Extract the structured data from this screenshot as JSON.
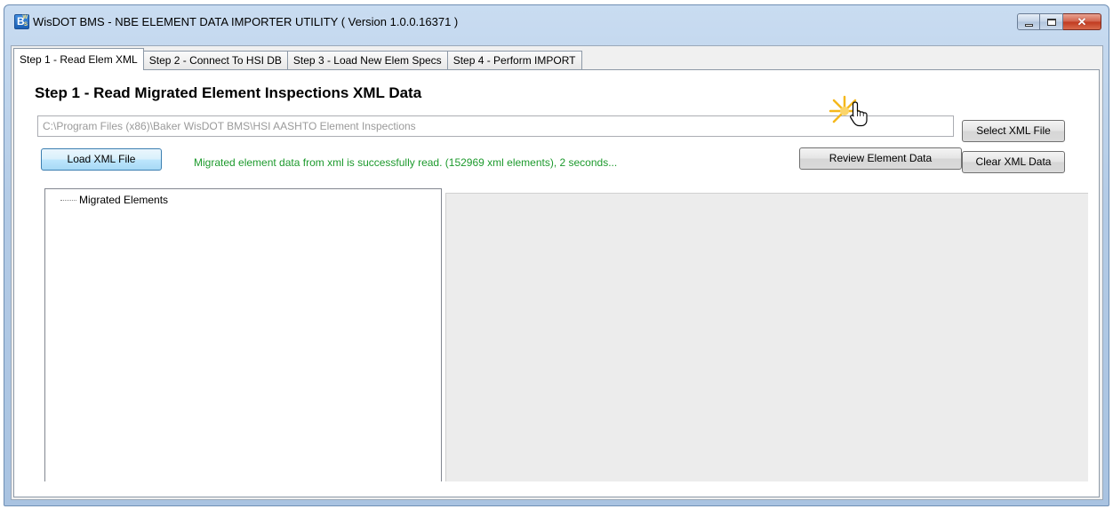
{
  "window": {
    "title": "WisDOT BMS - NBE ELEMENT DATA IMPORTER UTILITY ( Version 1.0.0.16371 )",
    "icon": "bms-app-icon",
    "icon_text": "B",
    "icon_sup": "W",
    "icon_sub": "S"
  },
  "tabs": [
    {
      "label": "Step 1 - Read Elem XML",
      "active": true
    },
    {
      "label": "Step 2 - Connect To HSI DB",
      "active": false
    },
    {
      "label": "Step 3 - Load New Elem Specs",
      "active": false
    },
    {
      "label": "Step 4 - Perform IMPORT",
      "active": false
    }
  ],
  "step1": {
    "heading": "Step 1 - Read Migrated Element Inspections XML Data",
    "path_value": "C:\\Program Files (x86)\\Baker WisDOT BMS\\HSI AASHTO Element Inspections",
    "select_xml_label": "Select XML File",
    "load_xml_label": "Load XML File",
    "status_message": "Migrated element data from xml is successfully read. (152969 xml elements), 2 seconds...",
    "review_label": "Review Element Data",
    "clear_label": "Clear XML Data",
    "tree_root": "Migrated Elements"
  },
  "colors": {
    "status_green": "#1d9a2d",
    "close_red": "#c0391f"
  }
}
